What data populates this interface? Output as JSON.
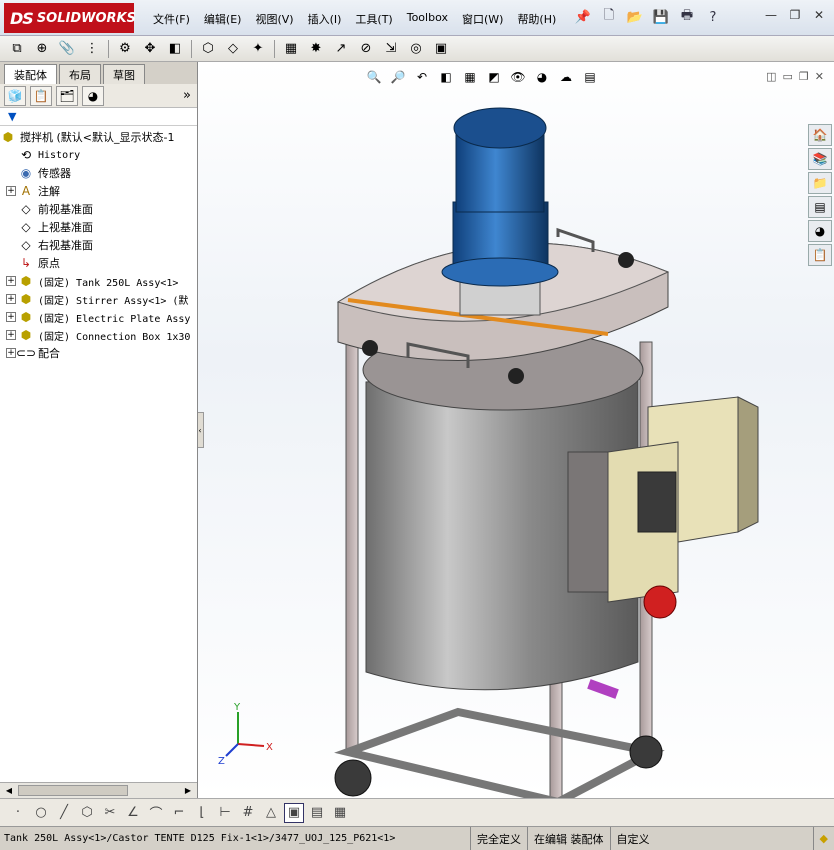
{
  "app": {
    "brand_prefix": "DS",
    "brand": "SOLIDWORKS"
  },
  "menu": [
    "文件(F)",
    "编辑(E)",
    "视图(V)",
    "插入(I)",
    "工具(T)",
    "Toolbox",
    "窗口(W)",
    "帮助(H)"
  ],
  "title_tools": {
    "help_glyph": "?",
    "pin_glyph": "📌"
  },
  "window_controls": {
    "minimize": "—",
    "restore": "❐",
    "close": "✕"
  },
  "panel": {
    "tabs": [
      "装配体",
      "布局",
      "草图"
    ],
    "active_tab": "装配体",
    "filter_glyph": "▼"
  },
  "tree": {
    "root": "搅拌机  (默认<默认_显示状态-1",
    "items": [
      {
        "label": "History",
        "icon": "history-icon",
        "mono": true,
        "expander": false
      },
      {
        "label": "传感器",
        "icon": "sensor-icon",
        "mono": false,
        "expander": false
      },
      {
        "label": "注解",
        "icon": "annotation-icon",
        "mono": false,
        "expander": true
      },
      {
        "label": "前视基准面",
        "icon": "plane-icon",
        "mono": false,
        "expander": false
      },
      {
        "label": "上视基准面",
        "icon": "plane-icon",
        "mono": false,
        "expander": false
      },
      {
        "label": "右视基准面",
        "icon": "plane-icon",
        "mono": false,
        "expander": false
      },
      {
        "label": "原点",
        "icon": "origin-icon",
        "mono": false,
        "expander": false
      },
      {
        "label": "(固定) Tank 250L Assy<1>",
        "icon": "assembly-icon",
        "mono": true,
        "expander": true
      },
      {
        "label": "(固定) Stirrer Assy<1> (默",
        "icon": "assembly-icon",
        "mono": true,
        "expander": true
      },
      {
        "label": "(固定) Electric Plate Assy",
        "icon": "assembly-icon",
        "mono": true,
        "expander": true
      },
      {
        "label": "(固定) Connection Box 1x30",
        "icon": "assembly-icon",
        "mono": true,
        "expander": true
      },
      {
        "label": "配合",
        "icon": "mates-icon",
        "mono": false,
        "expander": true
      }
    ]
  },
  "status": {
    "path": "Tank 250L Assy<1>/Castor TENTE D125 Fix-1<1>/3477_UOJ_125_P621<1>",
    "fully_defined": "完全定义",
    "editing": "在编辑 装配体",
    "custom": "自定义"
  },
  "axes": {
    "x": "X",
    "y": "Y",
    "z": "Z"
  },
  "colors": {
    "brand_red": "#c0101a",
    "motor_blue": "#1e5fa8",
    "tank_steel": "#8d8d8d",
    "box_beige": "#e8e1b8",
    "switch_red": "#d02020"
  }
}
